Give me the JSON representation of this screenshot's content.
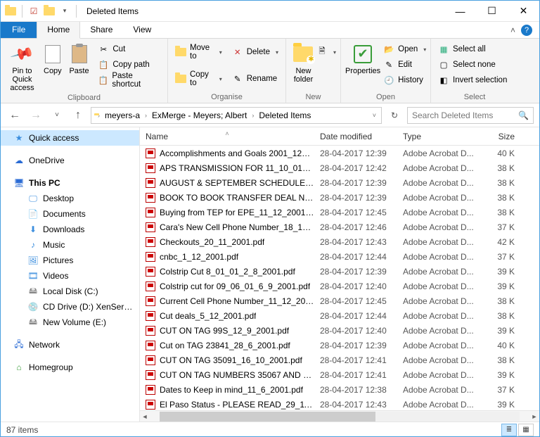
{
  "window": {
    "title": "Deleted Items"
  },
  "tabs": {
    "file": "File",
    "home": "Home",
    "share": "Share",
    "view": "View"
  },
  "ribbon": {
    "clipboard": {
      "label": "Clipboard",
      "pin": "Pin to Quick access",
      "copy": "Copy",
      "paste": "Paste",
      "cut": "Cut",
      "copy_path": "Copy path",
      "paste_shortcut": "Paste shortcut"
    },
    "organise": {
      "label": "Organise",
      "move_to": "Move to",
      "copy_to": "Copy to",
      "delete": "Delete",
      "rename": "Rename"
    },
    "new": {
      "label": "New",
      "new_folder": "New folder"
    },
    "open": {
      "label": "Open",
      "properties": "Properties",
      "open": "Open",
      "edit": "Edit",
      "history": "History"
    },
    "select": {
      "label": "Select",
      "select_all": "Select all",
      "select_none": "Select none",
      "invert": "Invert selection"
    }
  },
  "address": {
    "segments": [
      "meyers-a",
      "ExMerge - Meyers; Albert",
      "Deleted Items"
    ]
  },
  "search": {
    "placeholder": "Search Deleted Items"
  },
  "sidebar": {
    "quick_access": "Quick access",
    "onedrive": "OneDrive",
    "this_pc": "This PC",
    "desktop": "Desktop",
    "documents": "Documents",
    "downloads": "Downloads",
    "music": "Music",
    "pictures": "Pictures",
    "videos": "Videos",
    "local_disk": "Local Disk (C:)",
    "cd_drive": "CD Drive (D:) XenServer Tools",
    "new_volume": "New Volume (E:)",
    "network": "Network",
    "homegroup": "Homegroup"
  },
  "columns": {
    "name": "Name",
    "date": "Date modified",
    "type": "Type",
    "size": "Size"
  },
  "files": [
    {
      "name": "Accomplishments and Goals 2001_12_6_2...",
      "date": "28-04-2017 12:39",
      "type": "Adobe Acrobat D...",
      "size": "40 K"
    },
    {
      "name": "APS TRANSMISSION FOR 11_10_01_10_11...",
      "date": "28-04-2017 12:42",
      "type": "Adobe Acrobat D...",
      "size": "38 K"
    },
    {
      "name": "AUGUST & SEPTEMBER SCHEDULES_19_...",
      "date": "28-04-2017 12:39",
      "type": "Adobe Acrobat D...",
      "size": "38 K"
    },
    {
      "name": "BOOK TO BOOK TRANSFER DEAL NUMB...",
      "date": "28-04-2017 12:39",
      "type": "Adobe Acrobat D...",
      "size": "38 K"
    },
    {
      "name": "Buying from TEP for EPE_11_12_2001.pdf",
      "date": "28-04-2017 12:45",
      "type": "Adobe Acrobat D...",
      "size": "38 K"
    },
    {
      "name": "Cara's New Cell Phone Number_18_12_20...",
      "date": "28-04-2017 12:46",
      "type": "Adobe Acrobat D...",
      "size": "37 K"
    },
    {
      "name": "Checkouts_20_11_2001.pdf",
      "date": "28-04-2017 12:43",
      "type": "Adobe Acrobat D...",
      "size": "42 K"
    },
    {
      "name": "cnbc_1_12_2001.pdf",
      "date": "28-04-2017 12:44",
      "type": "Adobe Acrobat D...",
      "size": "37 K"
    },
    {
      "name": "Colstrip Cut 8_01_01_2_8_2001.pdf",
      "date": "28-04-2017 12:39",
      "type": "Adobe Acrobat D...",
      "size": "39 K"
    },
    {
      "name": "Colstrip cut for 09_06_01_6_9_2001.pdf",
      "date": "28-04-2017 12:40",
      "type": "Adobe Acrobat D...",
      "size": "39 K"
    },
    {
      "name": "Current Cell Phone Number_11_12_2001...",
      "date": "28-04-2017 12:45",
      "type": "Adobe Acrobat D...",
      "size": "38 K"
    },
    {
      "name": "Cut deals_5_12_2001.pdf",
      "date": "28-04-2017 12:44",
      "type": "Adobe Acrobat D...",
      "size": "38 K"
    },
    {
      "name": "CUT ON TAG 99S_12_9_2001.pdf",
      "date": "28-04-2017 12:40",
      "type": "Adobe Acrobat D...",
      "size": "39 K"
    },
    {
      "name": "Cut on TAG 23841_28_6_2001.pdf",
      "date": "28-04-2017 12:39",
      "type": "Adobe Acrobat D...",
      "size": "40 K"
    },
    {
      "name": "CUT ON TAG 35091_16_10_2001.pdf",
      "date": "28-04-2017 12:41",
      "type": "Adobe Acrobat D...",
      "size": "38 K"
    },
    {
      "name": "CUT ON TAG NUMBERS 35067 AND 3506...",
      "date": "28-04-2017 12:41",
      "type": "Adobe Acrobat D...",
      "size": "39 K"
    },
    {
      "name": "Dates to Keep in mind_11_6_2001.pdf",
      "date": "28-04-2017 12:38",
      "type": "Adobe Acrobat D...",
      "size": "37 K"
    },
    {
      "name": "El Paso Status - PLEASE READ_29_11_2001...",
      "date": "28-04-2017 12:43",
      "type": "Adobe Acrobat D...",
      "size": "39 K"
    }
  ],
  "status": {
    "count": "87 items"
  }
}
